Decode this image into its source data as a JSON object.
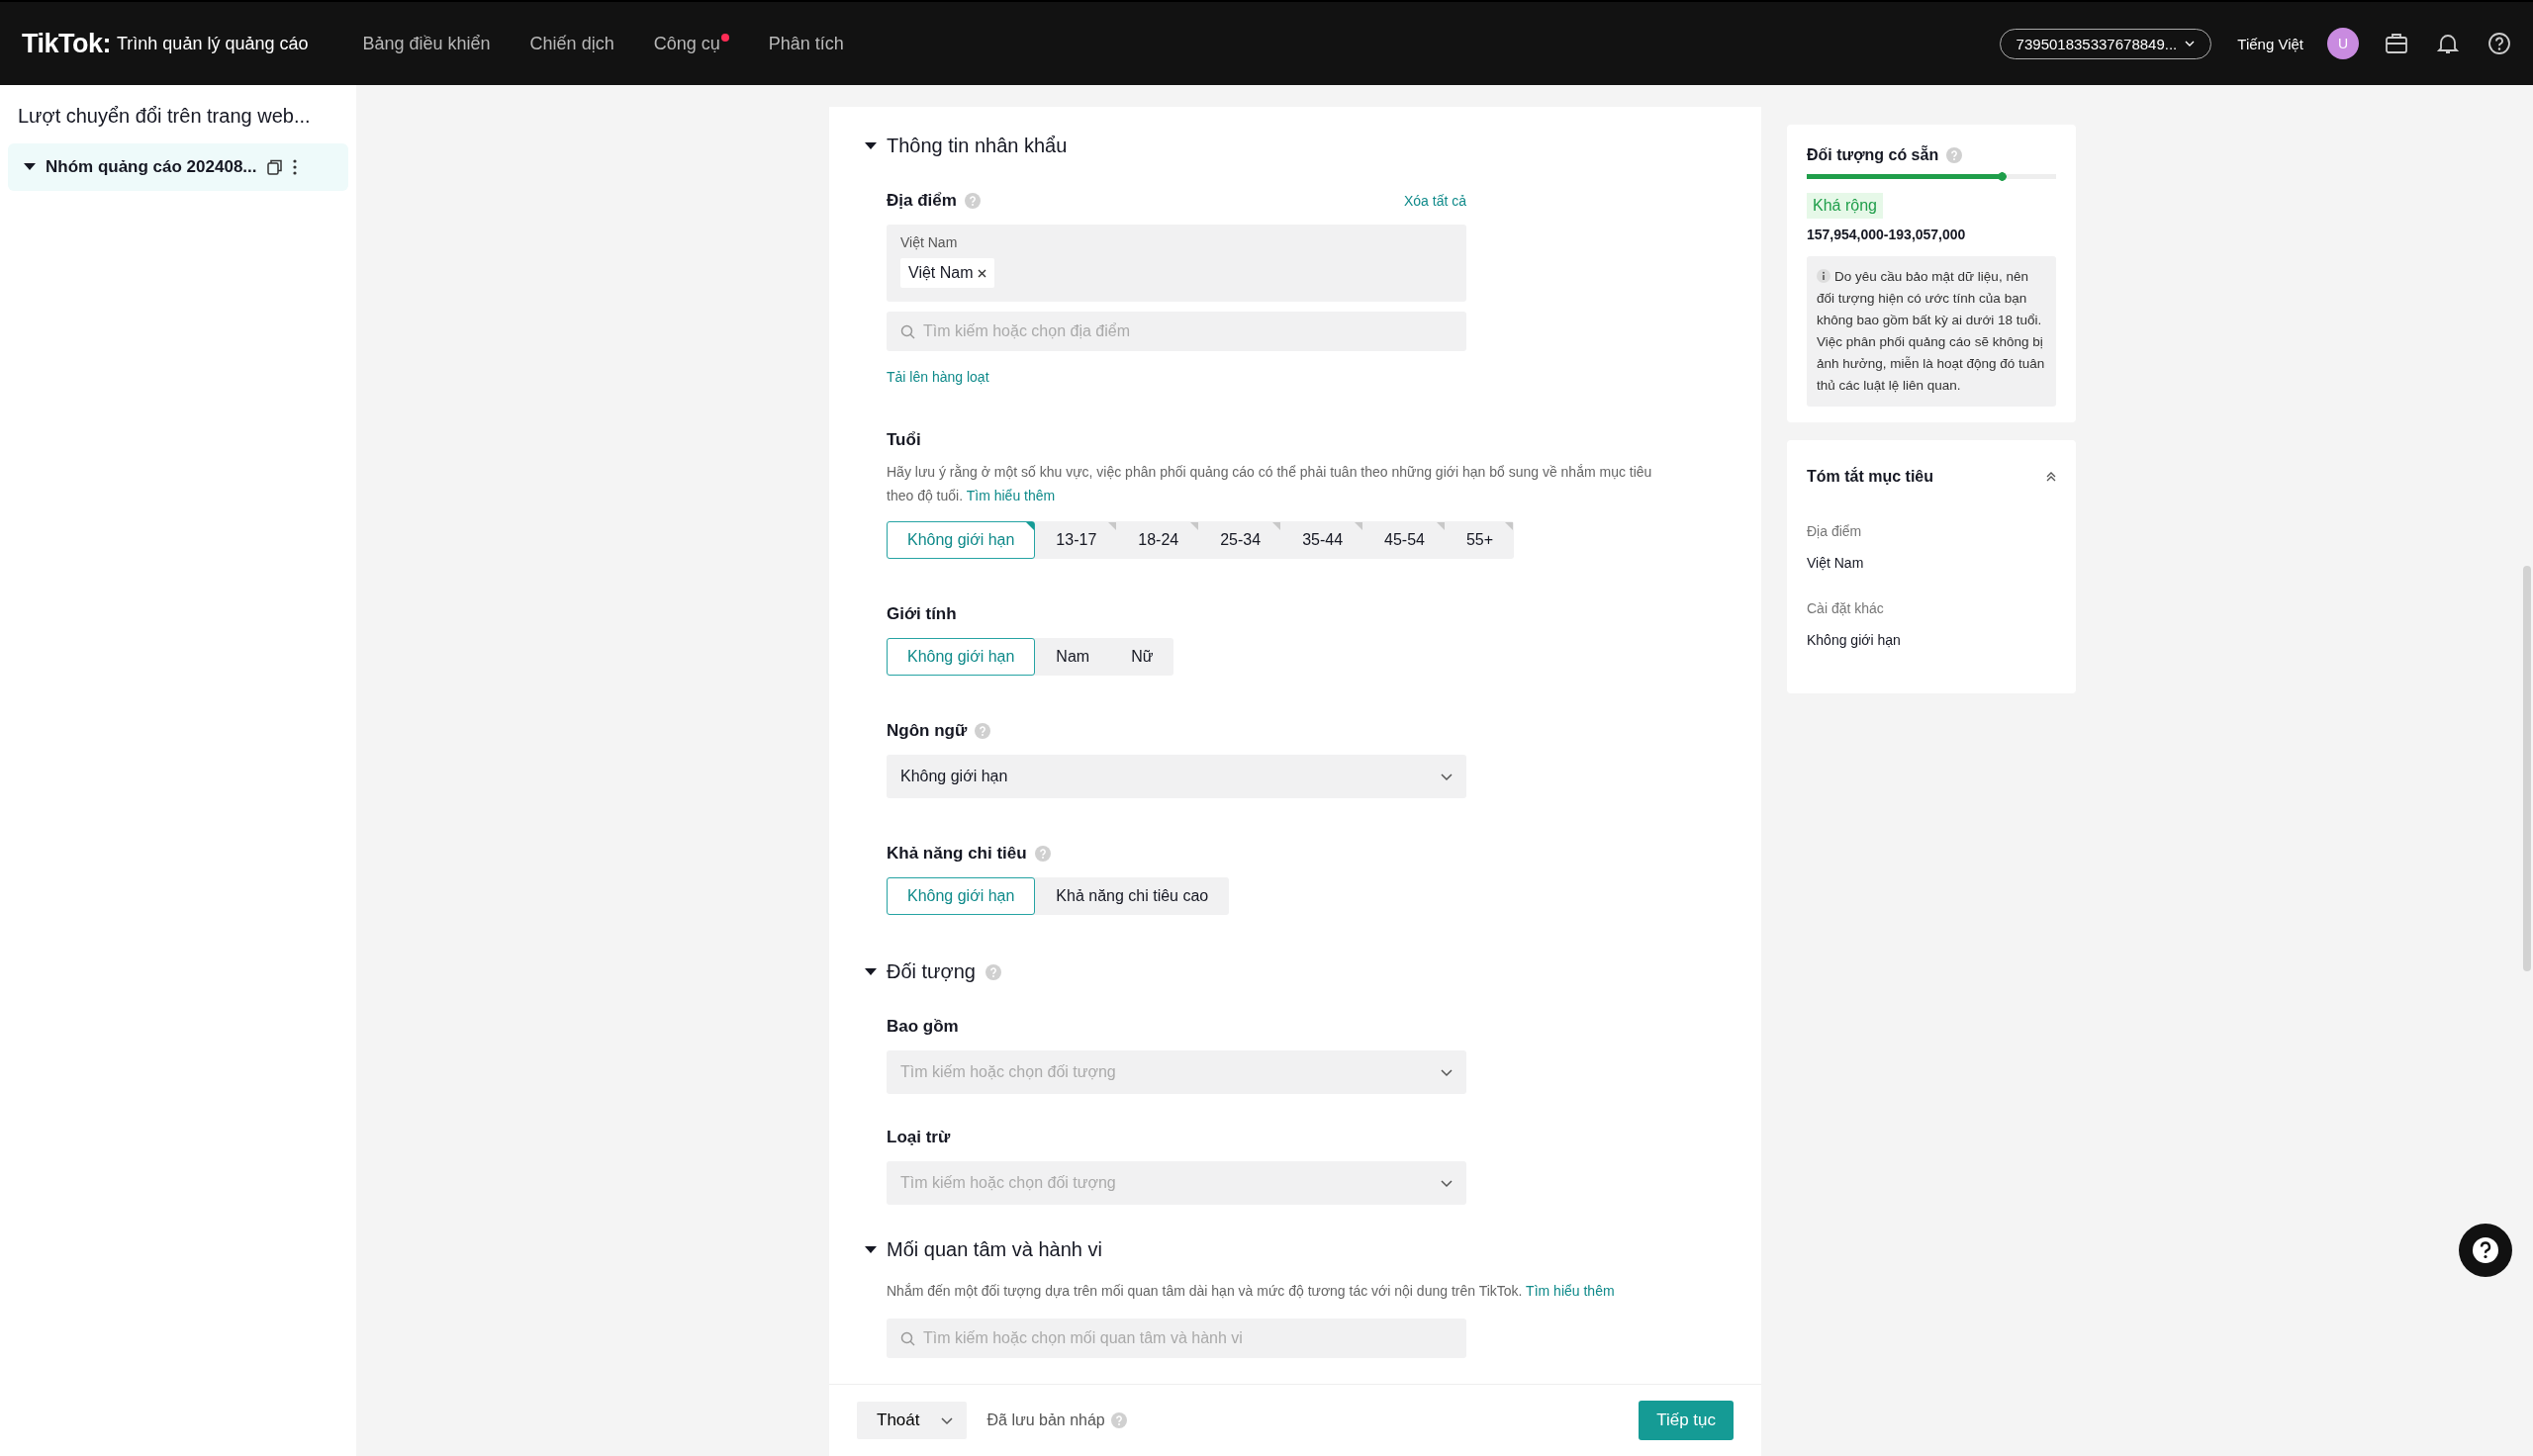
{
  "header": {
    "logo": "TikTok:",
    "product": "Trình quản lý quảng cáo",
    "nav": [
      {
        "label": "Bảng điều khiển",
        "selected": false,
        "dot": false
      },
      {
        "label": "Chiến dịch",
        "selected": false,
        "dot": false
      },
      {
        "label": "Công cụ",
        "selected": false,
        "dot": true
      },
      {
        "label": "Phân tích",
        "selected": false,
        "dot": false
      }
    ],
    "account": "739501835337678849...",
    "language": "Tiếng Việt",
    "avatar": "U"
  },
  "sidebar": {
    "title": "Lượt chuyển đổi trên trang web...",
    "items": [
      {
        "label": "Nhóm quảng cáo 202408...",
        "expanded": true,
        "selected": true
      }
    ]
  },
  "form": {
    "sections": [
      {
        "kind": "demographics",
        "title": "Thông tin nhân khẩu",
        "expanded": true,
        "location": {
          "label": "Địa điểm",
          "clear": "Xóa tất cả",
          "group": "Việt Nam",
          "tags": [
            "Việt Nam"
          ],
          "placeholder": "Tìm kiếm hoặc chọn địa điểm",
          "upload": "Tải lên hàng loạt"
        },
        "age": {
          "label": "Tuổi",
          "note": "Hãy lưu ý rằng ở một số khu vực, việc phân phối quảng cáo có thể phải tuân theo những giới hạn bổ sung về nhắm mục tiêu theo độ tuổi.",
          "link": "Tìm hiểu thêm",
          "options": [
            {
              "label": "Không giới hạn",
              "selected": true
            },
            {
              "label": "13-17",
              "selected": false
            },
            {
              "label": "18-24",
              "selected": false
            },
            {
              "label": "25-34",
              "selected": false
            },
            {
              "label": "35-44",
              "selected": false
            },
            {
              "label": "45-54",
              "selected": false
            },
            {
              "label": "55+",
              "selected": false
            }
          ]
        },
        "gender": {
          "label": "Giới tính",
          "options": [
            {
              "label": "Không giới hạn",
              "selected": true
            },
            {
              "label": "Nam",
              "selected": false
            },
            {
              "label": "Nữ",
              "selected": false
            }
          ]
        },
        "language": {
          "label": "Ngôn ngữ",
          "value": "Không giới hạn"
        },
        "spending": {
          "label": "Khả năng chi tiêu",
          "options": [
            {
              "label": "Không giới hạn",
              "selected": true
            },
            {
              "label": "Khả năng chi tiêu cao",
              "selected": false
            }
          ]
        }
      },
      {
        "kind": "audience",
        "title": "Đối tượng",
        "expanded": true,
        "fields": [
          {
            "label": "Bao gồm",
            "placeholder": "Tìm kiếm hoặc chọn đối tượng"
          },
          {
            "label": "Loại trừ",
            "placeholder": "Tìm kiếm hoặc chọn đối tượng"
          }
        ]
      },
      {
        "kind": "interests",
        "title": "Mối quan tâm và hành vi",
        "expanded": true,
        "note": "Nhắm đến một đối tượng dựa trên mối quan tâm dài hạn và mức độ tương tác với nội dung trên TikTok.",
        "link": "Tìm hiểu thêm",
        "placeholder": "Tìm kiếm hoặc chọn mối quan tâm và hành vi"
      }
    ]
  },
  "footer": {
    "exit": "Thoát",
    "saved": "Đã lưu bản nháp",
    "continue": "Tiếp tục"
  },
  "aside": {
    "audience": {
      "title": "Đối tượng có sẵn",
      "level": 0.8,
      "status": "Khá rộng",
      "range": "157,954,000-193,057,000",
      "notice": "Do yêu cầu bảo mật dữ liệu, nên đối tượng hiện có ước tính của bạn không bao gồm bất kỳ ai dưới 18 tuổi. Việc phân phối quảng cáo sẽ không bị ảnh hưởng, miễn là hoạt động đó tuân thủ các luật lệ liên quan."
    },
    "summary": {
      "title": "Tóm tắt mục tiêu",
      "expanded": true,
      "items": [
        {
          "label": "Địa điểm",
          "value": "Việt Nam"
        },
        {
          "label": "Cài đặt khác",
          "value": "Không giới hạn"
        }
      ]
    }
  }
}
